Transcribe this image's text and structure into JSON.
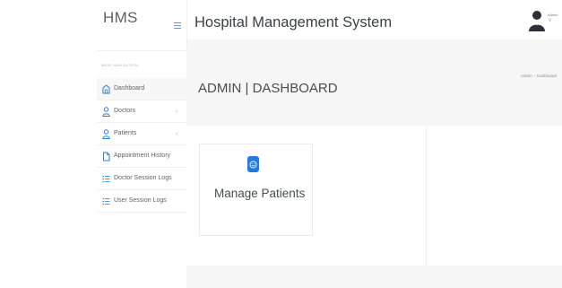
{
  "sidebar": {
    "brand": "HMS",
    "nav_caption": "Main Navigation",
    "items": [
      {
        "label": "Dashboard",
        "icon": "home-icon",
        "has_chevron": false,
        "active": true
      },
      {
        "label": "Doctors",
        "icon": "user-icon",
        "has_chevron": true,
        "active": false
      },
      {
        "label": "Patients",
        "icon": "user-icon",
        "has_chevron": true,
        "active": false
      },
      {
        "label": "Appointment History",
        "icon": "file-icon",
        "has_chevron": false,
        "active": false
      },
      {
        "label": "Doctor Session Logs",
        "icon": "list-icon",
        "has_chevron": false,
        "active": false
      },
      {
        "label": "User Session Logs",
        "icon": "list-icon",
        "has_chevron": false,
        "active": false
      }
    ]
  },
  "header": {
    "title": "Hospital Management System",
    "user_label": "Admin",
    "caret": "v"
  },
  "page": {
    "title": "ADMIN | DASHBOARD",
    "breadcrumb": {
      "root": "Admin",
      "separator": "/",
      "current": "Dashboard"
    }
  },
  "cards": [
    {
      "title": "Manage Patients",
      "icon": "smile-icon",
      "icon_color": "#1e7be8"
    }
  ],
  "colors": {
    "accent": "#1e7be8",
    "hamburger": "#6a9ad8",
    "panel": "#f7f7f8"
  }
}
